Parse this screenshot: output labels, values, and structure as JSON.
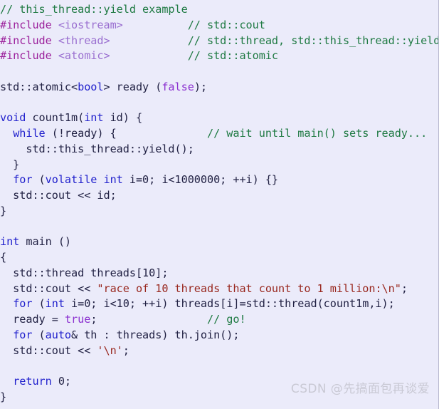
{
  "code_block": {
    "language": "cpp",
    "background_color": "#ebebfa",
    "border_color": "#b9b9cf",
    "colors": {
      "plain": "#222244",
      "comment": "#1f7a43",
      "preprocessor": "#9b1f9b",
      "header_name": "#9a6fd0",
      "keyword": "#1f1fcc",
      "literal": "#8b30d0",
      "string": "#99281f"
    },
    "lines": [
      {
        "index": 1,
        "text": "// this_thread::yield example",
        "tokens": [
          {
            "t": "// this_thread::yield example",
            "c": "tok-comment"
          }
        ]
      },
      {
        "index": 2,
        "text": "#include <iostream>          // std::cout",
        "tokens": [
          {
            "t": "#include ",
            "c": "tok-preproc"
          },
          {
            "t": "<iostream>",
            "c": "tok-header"
          },
          {
            "t": "          ",
            "c": "tok-plain"
          },
          {
            "t": "// std::cout",
            "c": "tok-comment"
          }
        ]
      },
      {
        "index": 3,
        "text": "#include <thread>            // std::thread, std::this_thread::yield",
        "tokens": [
          {
            "t": "#include ",
            "c": "tok-preproc"
          },
          {
            "t": "<thread>",
            "c": "tok-header"
          },
          {
            "t": "            ",
            "c": "tok-plain"
          },
          {
            "t": "// std::thread, std::this_thread::yield",
            "c": "tok-comment"
          }
        ]
      },
      {
        "index": 4,
        "text": "#include <atomic>            // std::atomic",
        "tokens": [
          {
            "t": "#include ",
            "c": "tok-preproc"
          },
          {
            "t": "<atomic>",
            "c": "tok-header"
          },
          {
            "t": "            ",
            "c": "tok-plain"
          },
          {
            "t": "// std::atomic",
            "c": "tok-comment"
          }
        ]
      },
      {
        "index": 5,
        "text": "",
        "tokens": []
      },
      {
        "index": 6,
        "text": "std::atomic<bool> ready (false);",
        "tokens": [
          {
            "t": "std::atomic<",
            "c": "tok-plain"
          },
          {
            "t": "bool",
            "c": "tok-keyword"
          },
          {
            "t": "> ready (",
            "c": "tok-plain"
          },
          {
            "t": "false",
            "c": "tok-literal"
          },
          {
            "t": ");",
            "c": "tok-plain"
          }
        ]
      },
      {
        "index": 7,
        "text": "",
        "tokens": []
      },
      {
        "index": 8,
        "text": "void count1m(int id) {",
        "tokens": [
          {
            "t": "void",
            "c": "tok-keyword"
          },
          {
            "t": " count1m(",
            "c": "tok-plain"
          },
          {
            "t": "int",
            "c": "tok-keyword"
          },
          {
            "t": " id) {",
            "c": "tok-plain"
          }
        ]
      },
      {
        "index": 9,
        "text": "  while (!ready) {              // wait until main() sets ready...",
        "tokens": [
          {
            "t": "  ",
            "c": "tok-plain"
          },
          {
            "t": "while",
            "c": "tok-keyword"
          },
          {
            "t": " (!ready) {",
            "c": "tok-plain"
          },
          {
            "t": "              ",
            "c": "tok-plain"
          },
          {
            "t": "// wait until main() sets ready...",
            "c": "tok-comment"
          }
        ]
      },
      {
        "index": 10,
        "text": "    std::this_thread::yield();",
        "tokens": [
          {
            "t": "    std::this_thread::yield();",
            "c": "tok-plain"
          }
        ]
      },
      {
        "index": 11,
        "text": "  }",
        "tokens": [
          {
            "t": "  }",
            "c": "tok-plain"
          }
        ]
      },
      {
        "index": 12,
        "text": "  for (volatile int i=0; i<1000000; ++i) {}",
        "tokens": [
          {
            "t": "  ",
            "c": "tok-plain"
          },
          {
            "t": "for",
            "c": "tok-keyword"
          },
          {
            "t": " (",
            "c": "tok-plain"
          },
          {
            "t": "volatile",
            "c": "tok-keyword"
          },
          {
            "t": " ",
            "c": "tok-plain"
          },
          {
            "t": "int",
            "c": "tok-keyword"
          },
          {
            "t": " i=0; i<1000000; ++i) {}",
            "c": "tok-plain"
          }
        ]
      },
      {
        "index": 13,
        "text": "  std::cout << id;",
        "tokens": [
          {
            "t": "  std::cout << id;",
            "c": "tok-plain"
          }
        ]
      },
      {
        "index": 14,
        "text": "}",
        "tokens": [
          {
            "t": "}",
            "c": "tok-plain"
          }
        ]
      },
      {
        "index": 15,
        "text": "",
        "tokens": []
      },
      {
        "index": 16,
        "text": "int main ()",
        "tokens": [
          {
            "t": "int",
            "c": "tok-keyword"
          },
          {
            "t": " main ()",
            "c": "tok-plain"
          }
        ]
      },
      {
        "index": 17,
        "text": "{",
        "tokens": [
          {
            "t": "{",
            "c": "tok-plain"
          }
        ]
      },
      {
        "index": 18,
        "text": "  std::thread threads[10];",
        "tokens": [
          {
            "t": "  std::thread threads[10];",
            "c": "tok-plain"
          }
        ]
      },
      {
        "index": 19,
        "text": "  std::cout << \"race of 10 threads that count to 1 million:\\n\";",
        "tokens": [
          {
            "t": "  std::cout << ",
            "c": "tok-plain"
          },
          {
            "t": "\"race of 10 threads that count to 1 million:\\n\"",
            "c": "tok-string"
          },
          {
            "t": ";",
            "c": "tok-plain"
          }
        ]
      },
      {
        "index": 20,
        "text": "  for (int i=0; i<10; ++i) threads[i]=std::thread(count1m,i);",
        "tokens": [
          {
            "t": "  ",
            "c": "tok-plain"
          },
          {
            "t": "for",
            "c": "tok-keyword"
          },
          {
            "t": " (",
            "c": "tok-plain"
          },
          {
            "t": "int",
            "c": "tok-keyword"
          },
          {
            "t": " i=0; i<10; ++i) threads[i]=std::thread(count1m,i);",
            "c": "tok-plain"
          }
        ]
      },
      {
        "index": 21,
        "text": "  ready = true;                 // go!",
        "tokens": [
          {
            "t": "  ready = ",
            "c": "tok-plain"
          },
          {
            "t": "true",
            "c": "tok-literal"
          },
          {
            "t": ";",
            "c": "tok-plain"
          },
          {
            "t": "                 ",
            "c": "tok-plain"
          },
          {
            "t": "// go!",
            "c": "tok-comment"
          }
        ]
      },
      {
        "index": 22,
        "text": "  for (auto& th : threads) th.join();",
        "tokens": [
          {
            "t": "  ",
            "c": "tok-plain"
          },
          {
            "t": "for",
            "c": "tok-keyword"
          },
          {
            "t": " (",
            "c": "tok-plain"
          },
          {
            "t": "auto",
            "c": "tok-keyword"
          },
          {
            "t": "& th : threads) th.join();",
            "c": "tok-plain"
          }
        ]
      },
      {
        "index": 23,
        "text": "  std::cout << '\\n';",
        "tokens": [
          {
            "t": "  std::cout << ",
            "c": "tok-plain"
          },
          {
            "t": "'\\n'",
            "c": "tok-string"
          },
          {
            "t": ";",
            "c": "tok-plain"
          }
        ]
      },
      {
        "index": 24,
        "text": "",
        "tokens": []
      },
      {
        "index": 25,
        "text": "  return 0;",
        "tokens": [
          {
            "t": "  ",
            "c": "tok-plain"
          },
          {
            "t": "return",
            "c": "tok-keyword"
          },
          {
            "t": " 0;",
            "c": "tok-plain"
          }
        ]
      },
      {
        "index": 26,
        "text": "}",
        "tokens": [
          {
            "t": "}",
            "c": "tok-plain"
          }
        ]
      }
    ]
  },
  "watermark": {
    "text": "CSDN @先搞面包再谈爱",
    "color": "#c9c9d4"
  }
}
